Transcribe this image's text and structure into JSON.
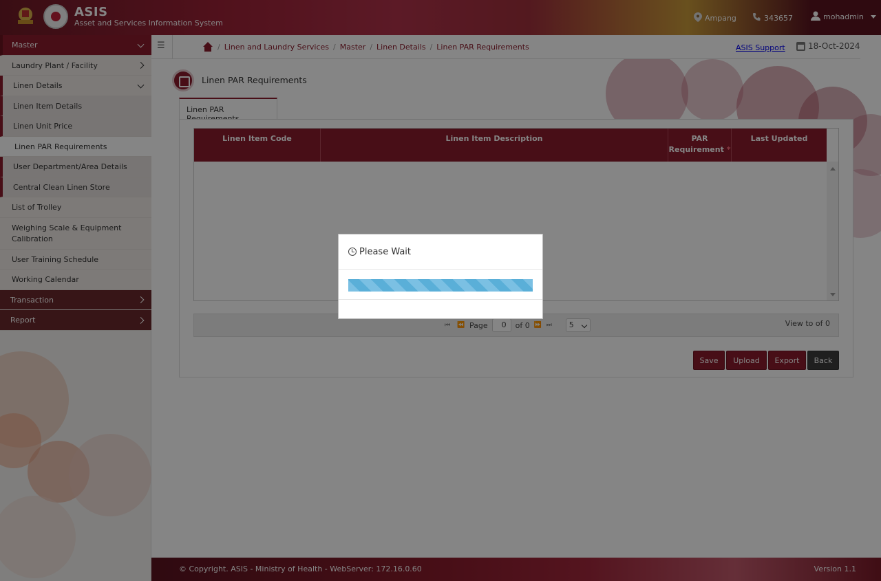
{
  "header": {
    "brand_title": "ASIS",
    "brand_subtitle": "Asset and Services Information System",
    "location": "Ampang",
    "phone": "343657",
    "user": "mohadmin"
  },
  "sidebar": {
    "master": "Master",
    "items": [
      {
        "label": "Laundry Plant / Facility"
      },
      {
        "label": "Linen Details"
      },
      {
        "label": "Linen Item Details"
      },
      {
        "label": "Linen Unit Price"
      },
      {
        "label": "Linen PAR Requirements"
      },
      {
        "label": "User Department/Area Details"
      },
      {
        "label": "Central Clean Linen Store"
      },
      {
        "label": "List of Trolley"
      },
      {
        "label": "Weighing Scale & Equipment Calibration"
      },
      {
        "label": "User Training Schedule"
      },
      {
        "label": "Working Calendar"
      }
    ],
    "transaction": "Transaction",
    "report": "Report"
  },
  "breadcrumb": [
    "Linen and Laundry Services",
    "Master",
    "Linen Details",
    "Linen PAR Requirements"
  ],
  "support_link": "ASIS Support",
  "date": "18-Oct-2024",
  "page_title": "Linen PAR Requirements",
  "tab_label": "Linen PAR Requirements",
  "grid": {
    "col_code": "Linen Item Code",
    "col_desc": "Linen Item Description",
    "col_par": "PAR Requirement",
    "col_par_req": "*",
    "col_updated": "Last Updated"
  },
  "pager": {
    "page_label": "Page",
    "page_value": "0",
    "of_label": "of 0",
    "page_size": "5",
    "view_text": "View to of 0"
  },
  "buttons": {
    "save": "Save",
    "upload": "Upload",
    "export": "Export",
    "back": "Back"
  },
  "footer": {
    "copyright": "© Copyright. ASIS - Ministry of Health - WebServer: 172.16.0.60",
    "version": "Version 1.1"
  },
  "modal": {
    "title": "Please Wait"
  },
  "colors": {
    "brand": "#8a1c2c",
    "progress": "#5aafd8"
  }
}
